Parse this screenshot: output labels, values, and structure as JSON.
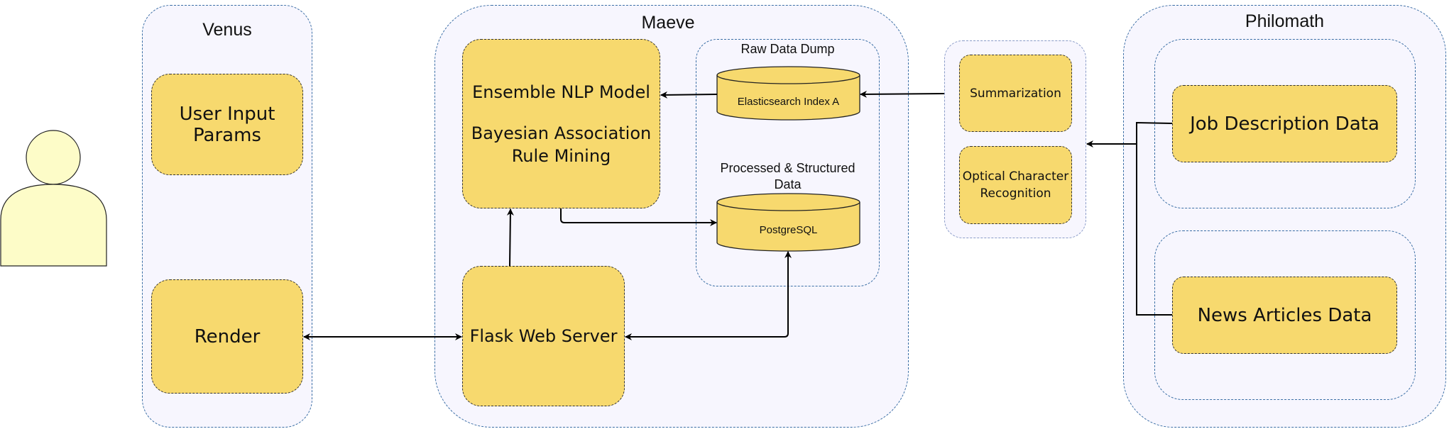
{
  "colors": {
    "box_fill": "#f7d96e",
    "group_fill": "#f7f6fe",
    "group_border": "#3a6ea5",
    "person_fill": "#fdfcc8"
  },
  "icons": {
    "user": "person-icon"
  },
  "venus": {
    "title": "Venus",
    "user_input": "User Input Params",
    "render": "Render"
  },
  "maeve": {
    "title": "Maeve",
    "model_line1": "Ensemble NLP Model",
    "model_line2": "Bayesian Association Rule Mining",
    "flask": "Flask Web Server",
    "raw_dump": {
      "title": "Raw Data Dump",
      "elasticsearch": "Elasticsearch Index A",
      "processed_title": "Processed & Structured Data",
      "postgres": "PostgreSQL"
    }
  },
  "processing": {
    "summarization": "Summarization",
    "ocr": "Optical Character Recognition"
  },
  "philomath": {
    "title": "Philomath",
    "job": "Job Description Data",
    "news": "News Articles Data"
  }
}
